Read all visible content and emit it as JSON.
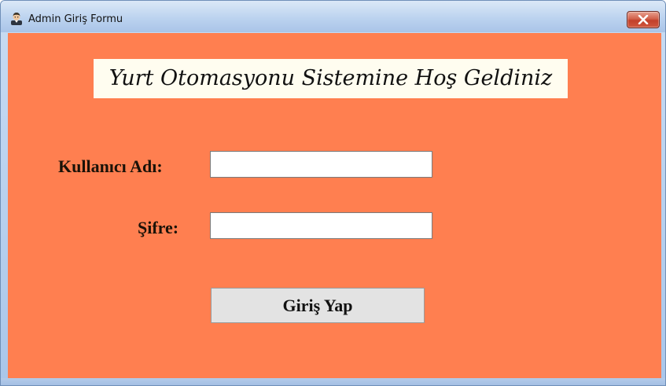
{
  "window": {
    "title": "Admin Giriş Formu",
    "icon": "admin-user-icon",
    "close_icon": "close-icon"
  },
  "form": {
    "welcome_text": "Yurt Otomasyonu Sistemine Hoş Geldiniz",
    "username_label": "Kullanıcı Adı:",
    "username_value": "",
    "password_label": "Şifre:",
    "password_value": "",
    "login_button_label": "Giriş Yap"
  },
  "colors": {
    "background": "#ff7f50",
    "welcome_box": "#fffdf0",
    "button": "#e3e3e3",
    "close_button": "#c2402b"
  }
}
